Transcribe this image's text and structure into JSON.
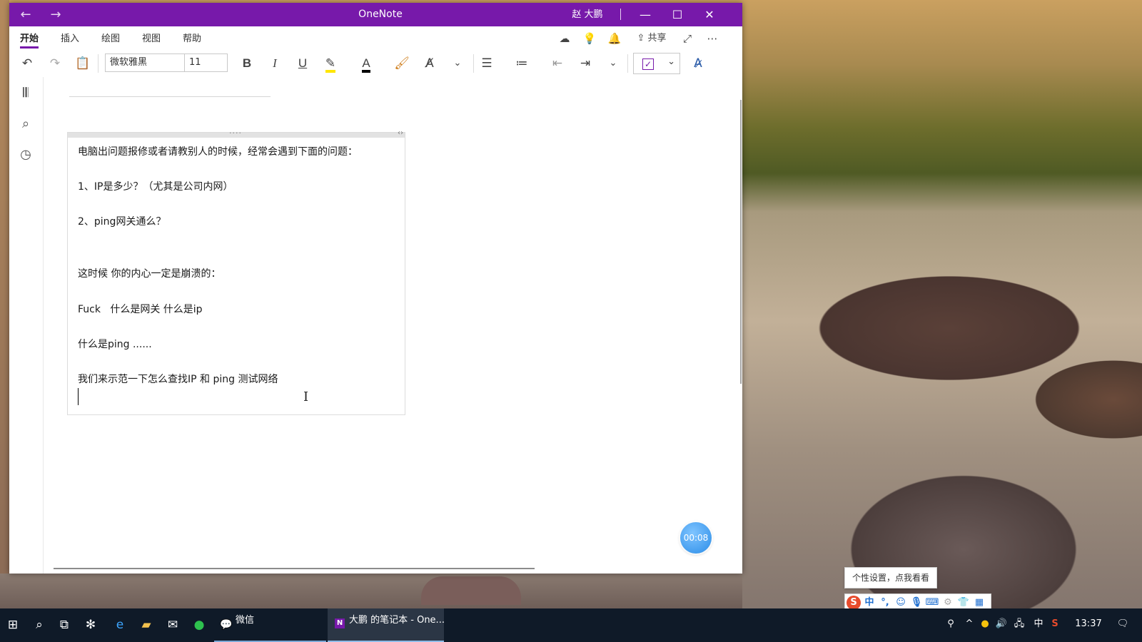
{
  "window": {
    "title": "OneNote",
    "user": "赵 大鹏",
    "back_icon": "←",
    "forward_icon": "→",
    "minimize_icon": "—",
    "maximize_icon": "☐",
    "close_icon": "✕"
  },
  "menu": {
    "tabs": [
      "开始",
      "插入",
      "绘图",
      "视图",
      "帮助"
    ],
    "active_tab": "开始",
    "share_label": "共享"
  },
  "toolbar": {
    "font_name": "微软雅黑",
    "font_size": "11",
    "bold": "B",
    "italic": "I",
    "underline": "U",
    "font_color_letter": "A"
  },
  "note": {
    "lines": [
      "电脑出问题报修或者请教别人的时候，经常会遇到下面的问题：",
      "1、IP是多少？（尤其是公司内网）",
      "2、ping网关通么？",
      "这时候 你的内心一定是崩溃的：",
      "Fuck   什么是网关 什么是ip",
      "什么是ping ......",
      "我们来示范一下怎么查找IP 和 ping 测试网络"
    ]
  },
  "timer": "00:08",
  "ime": {
    "tooltip": "个性设置，点我看看",
    "mode": "中",
    "punct": "°,"
  },
  "taskbar": {
    "wechat_label": "微信",
    "onenote_label": "大鹏 的笔记本 - One...",
    "clock": "13:37",
    "ime_indicator": "中"
  },
  "colors": {
    "accent": "#7719aa",
    "taskbar": "#0f1a28",
    "timer": "#2b8de8"
  }
}
